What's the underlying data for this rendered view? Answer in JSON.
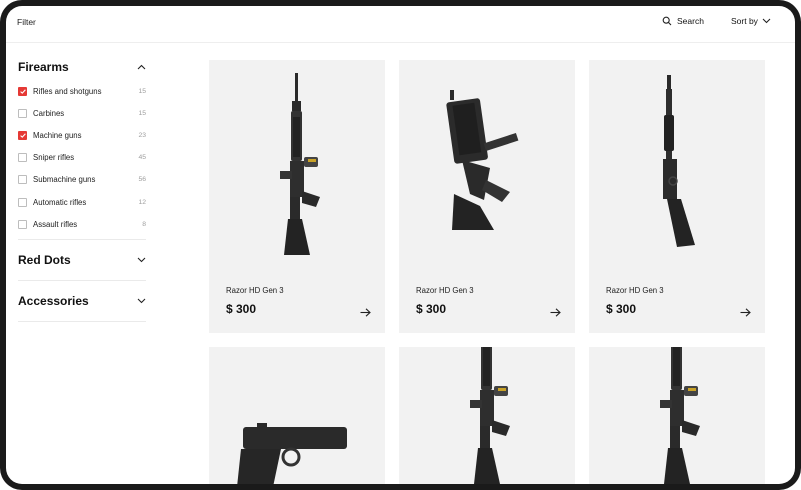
{
  "topbar": {
    "filter_label": "Filter",
    "search_label": "Search",
    "sort_label": "Sort by"
  },
  "sidebar": {
    "sections": [
      {
        "title": "Firearms",
        "expanded": true,
        "options": [
          {
            "label": "Rifles and shotguns",
            "count": "15",
            "checked": true
          },
          {
            "label": "Carbines",
            "count": "15",
            "checked": false
          },
          {
            "label": "Machine guns",
            "count": "23",
            "checked": true
          },
          {
            "label": "Sniper rifles",
            "count": "45",
            "checked": false
          },
          {
            "label": "Submachine guns",
            "count": "56",
            "checked": false
          },
          {
            "label": "Automatic rifles",
            "count": "12",
            "checked": false
          },
          {
            "label": "Assault rifles",
            "count": "8",
            "checked": false
          }
        ]
      },
      {
        "title": "Red Dots",
        "expanded": false
      },
      {
        "title": "Accessories",
        "expanded": false
      }
    ]
  },
  "products": [
    {
      "name": "Razor HD Gen 3",
      "price": "$ 300",
      "image": "ar15-rifle"
    },
    {
      "name": "Razor HD Gen 3",
      "price": "$ 300",
      "image": "compact-smg"
    },
    {
      "name": "Razor HD Gen 3",
      "price": "$ 300",
      "image": "pump-shotgun"
    },
    {
      "name": "",
      "price": "",
      "image": "pistol"
    },
    {
      "name": "",
      "price": "",
      "image": "ar15-rifle"
    },
    {
      "name": "",
      "price": "",
      "image": "ar15-rifle"
    }
  ],
  "colors": {
    "accent": "#e53935",
    "card_bg": "#f2f2f2"
  }
}
